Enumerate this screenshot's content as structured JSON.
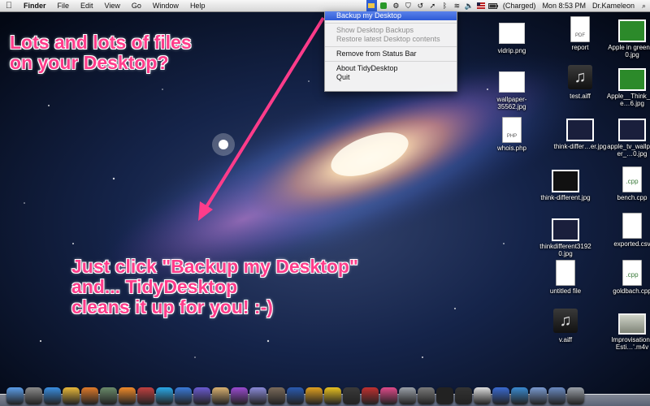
{
  "menubar": {
    "apple_icon": "apple-icon",
    "items": [
      "Finder",
      "File",
      "Edit",
      "View",
      "Go",
      "Window",
      "Help"
    ],
    "battery_status": "(Charged)",
    "clock": "Mon 8:53 PM",
    "user": "Dr.Kameleon"
  },
  "dropdown": {
    "backup": "Backup my Desktop",
    "show_backups": "Show Desktop Backups",
    "restore": "Restore latest Desktop contents",
    "remove": "Remove from Status Bar",
    "about": "About TidyDesktop",
    "quit": "Quit"
  },
  "captions": {
    "top": "Lots and lots of files\non your Desktop?",
    "bottom": "Just click \"Backup my Desktop\"\nand... TidyDesktop\ncleans it up for you! :-)"
  },
  "desktop_icons": [
    {
      "label": "vidrip.png",
      "kind": "img"
    },
    {
      "label": "report",
      "kind": "doc",
      "badge": "PDF"
    },
    {
      "label": "Apple in green…0.jpg",
      "kind": "img-green"
    },
    {
      "label": "wallpaper-35562.jpg",
      "kind": "img"
    },
    {
      "label": "test.aiff",
      "kind": "music"
    },
    {
      "label": "Apple__Think_Gre…6.jpg",
      "kind": "img-green"
    },
    {
      "label": "whois.php",
      "kind": "doc",
      "badge": "PHP"
    },
    {
      "label": "think-differ…er.jpg",
      "kind": "img-dark"
    },
    {
      "label": "apple_tv_wallpaper_…0.jpg",
      "kind": "img-dark"
    },
    {
      "label": "think-different.jpg",
      "kind": "img-black"
    },
    {
      "label": "bench.cpp",
      "kind": "cpp",
      "badge": ".cpp"
    },
    {
      "label": "thinkdifferent31920.jpg",
      "kind": "img-dark"
    },
    {
      "label": "exported.csv",
      "kind": "doc",
      "badge": ""
    },
    {
      "label": "untitled file",
      "kind": "doc",
      "badge": ""
    },
    {
      "label": "goldbach.cpp",
      "kind": "cpp",
      "badge": ".cpp"
    },
    {
      "label": "v.aiff",
      "kind": "music"
    },
    {
      "label": "Improvisations Esti…'.m4v",
      "kind": "movie"
    }
  ],
  "dock_apps": [
    "finder",
    "launchpad",
    "safari",
    "chrome",
    "firefox",
    "deviantart",
    "xampp",
    "app",
    "skype",
    "dropbox",
    "stack",
    "package",
    "app",
    "browser",
    "gimp",
    "word",
    "feed",
    "fireworks",
    "flashbuilder",
    "photo-booth",
    "heart",
    "preview",
    "prefs",
    "terminal",
    "console",
    "textedit",
    "xcode",
    "itunes",
    "docs",
    "downloads",
    "trash"
  ],
  "colors": {
    "caption": "#ff3c8a",
    "highlight": "#2e5ad6"
  }
}
